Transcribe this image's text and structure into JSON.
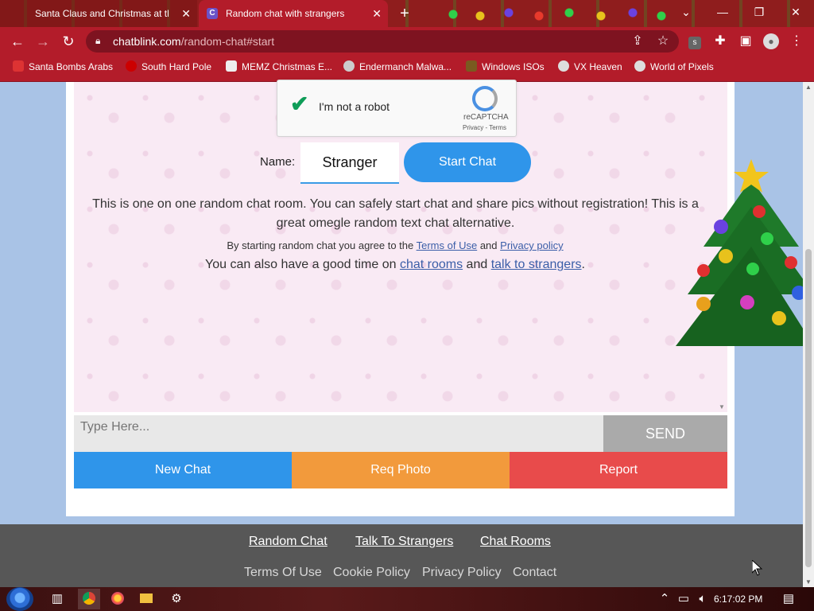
{
  "browser": {
    "tabs": [
      {
        "title": "Santa Claus and Christmas at the",
        "active": false
      },
      {
        "title": "Random chat with strangers",
        "active": true,
        "favicon_letter": "C"
      }
    ],
    "new_tab": "+",
    "url_host": "chatblink.com",
    "url_path": "/random-chat#start",
    "bookmarks": [
      {
        "label": "Santa Bombs Arabs",
        "icon": "bomb-icon"
      },
      {
        "label": "South Hard Pole",
        "icon": "snowflake-icon"
      },
      {
        "label": "MEMZ Christmas E...",
        "icon": "page-icon"
      },
      {
        "label": "Endermanch Malwa...",
        "icon": "skull-icon"
      },
      {
        "label": "Windows ISOs",
        "icon": "person-icon"
      },
      {
        "label": "VX Heaven",
        "icon": "vx-icon"
      },
      {
        "label": "World of Pixels",
        "icon": "globe-icon"
      }
    ]
  },
  "captcha": {
    "label": "I'm not a robot",
    "brand": "reCAPTCHA",
    "links": "Privacy - Terms"
  },
  "start": {
    "name_label": "Name:",
    "name_value": "Stranger",
    "start_button": "Start Chat"
  },
  "intro": {
    "description": "This is one on one random chat room. You can safely start chat and share pics without registration! This is a great omegle random text chat alternative.",
    "agree_prefix": "By starting random chat you agree to the",
    "terms_link": "Terms of Use",
    "agree_and": "and",
    "privacy_link": "Privacy policy",
    "also_prefix": "You can also have a good time on",
    "chat_rooms_link": "chat rooms",
    "also_and": "and",
    "talk_link": "talk to strangers",
    "also_suffix": "."
  },
  "composer": {
    "placeholder": "Type Here...",
    "send": "SEND"
  },
  "actions": {
    "new_chat": "New Chat",
    "req_photo": "Req Photo",
    "report": "Report"
  },
  "footer": {
    "row1": [
      "Random Chat",
      "Talk To Strangers",
      "Chat Rooms"
    ],
    "row2": [
      "Terms Of Use",
      "Cookie Policy",
      "Privacy Policy",
      "Contact"
    ]
  },
  "taskbar": {
    "time": "6:17:02 PM"
  },
  "colors": {
    "chrome_red": "#b31c2a",
    "start_blue": "#2f95ea",
    "req_orange": "#f29a3c",
    "report_red": "#e84b4b",
    "send_gray": "#aaaaaa",
    "footer_gray": "#575757"
  }
}
